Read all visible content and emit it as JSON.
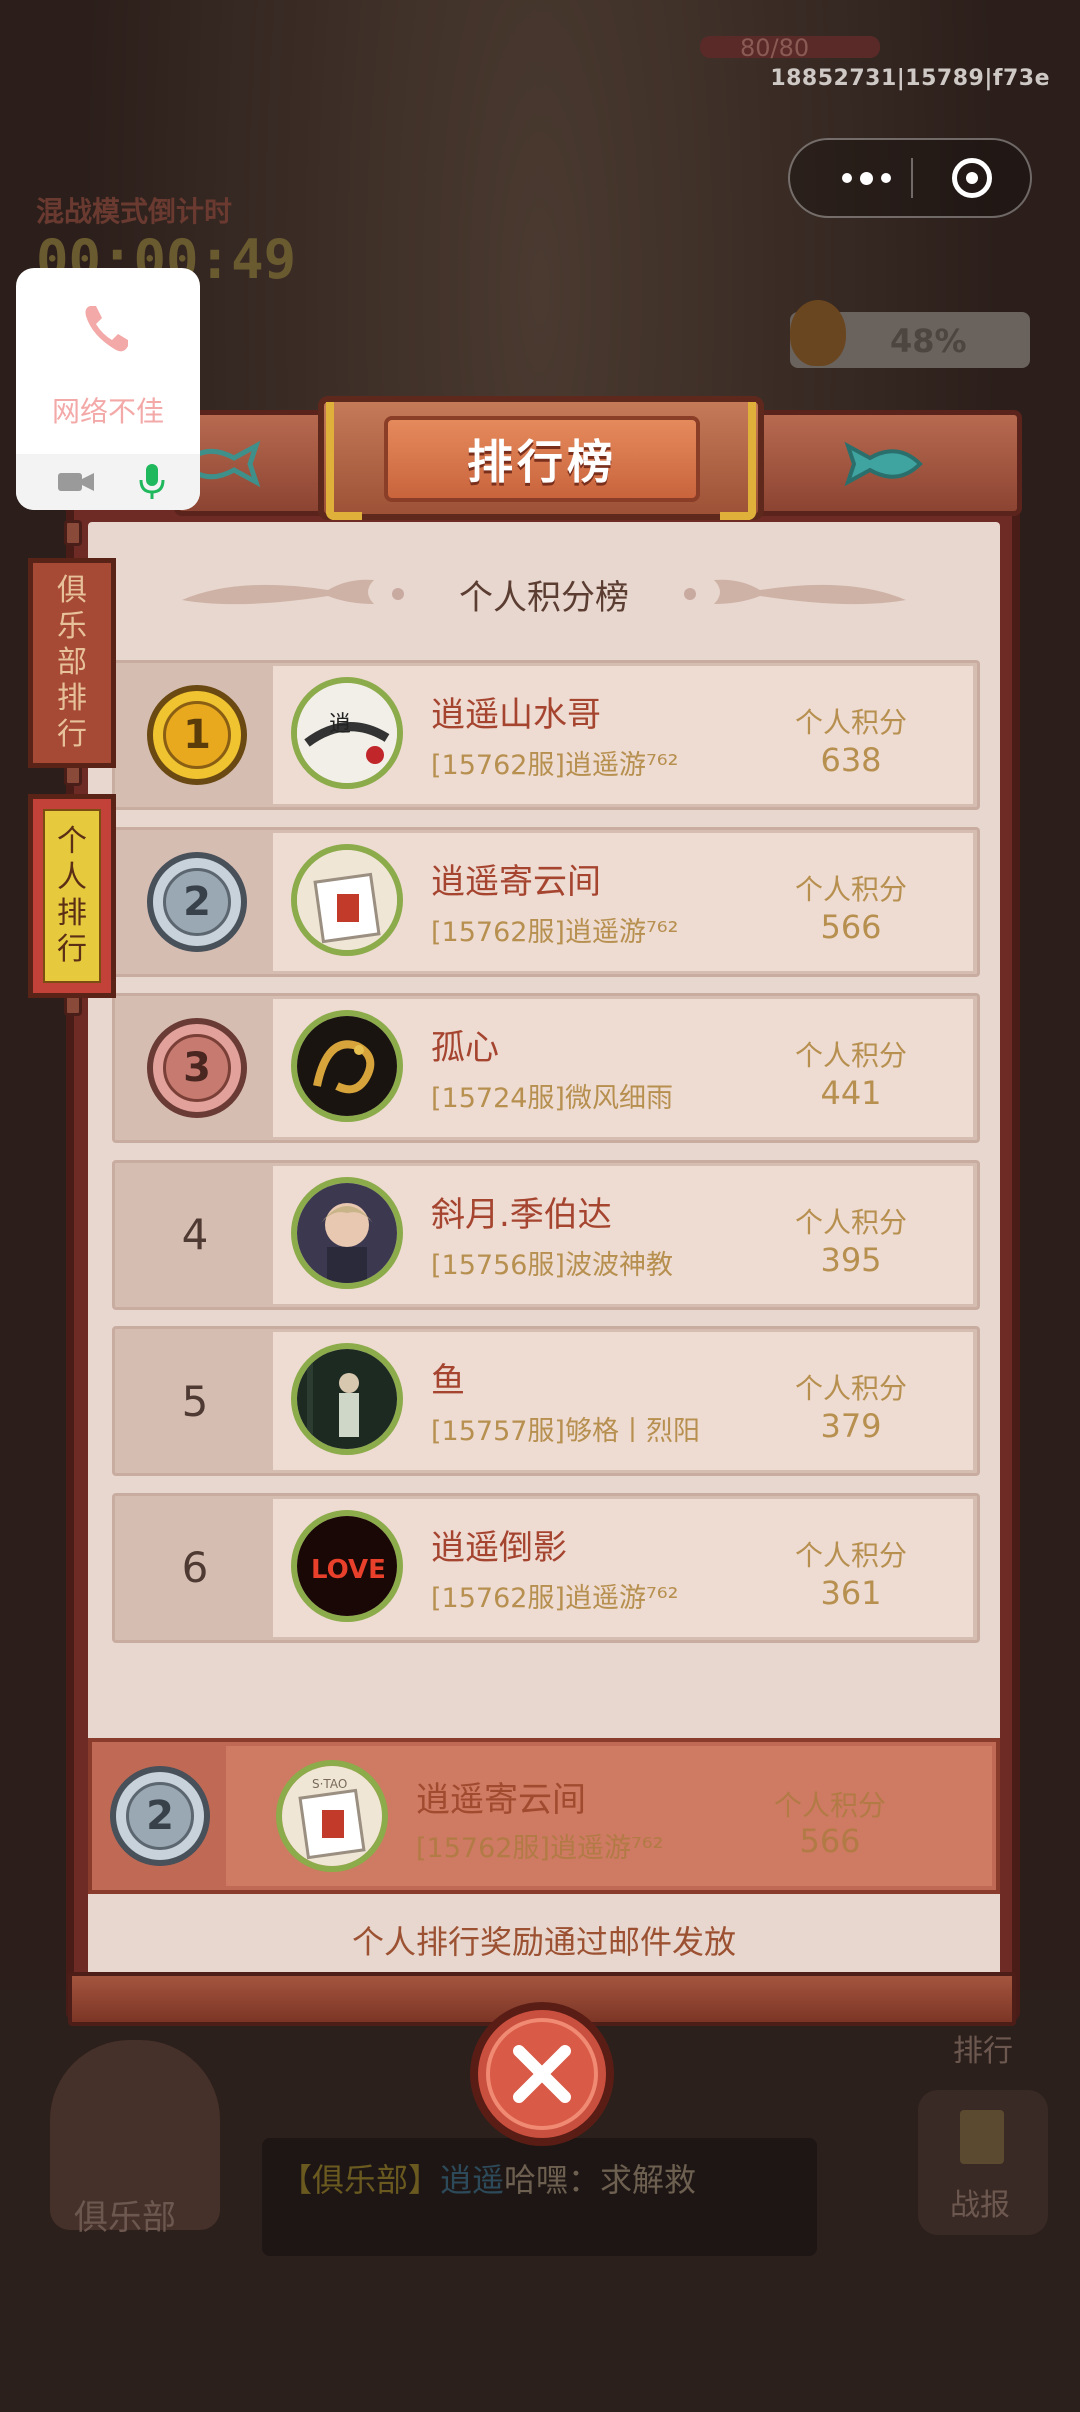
{
  "status": {
    "build_id": "18852731|15789|f73e"
  },
  "background": {
    "hp_text": "80/80",
    "countdown_label": "混战模式倒计时",
    "countdown": "00:00:49",
    "progress_text": "48%",
    "club_label": "俱乐部",
    "chat_channel": "【俱乐部】",
    "chat_nick": "逍遥",
    "chat_text": "哈嘿：求解救",
    "rank_side_label": "排行",
    "report_label": "战报"
  },
  "voip": {
    "status": "网络不佳",
    "color_phone": "#f3a9a8",
    "color_mic": "#1fb85c"
  },
  "leaderboard": {
    "title": "排行榜",
    "subtitle": "个人积分榜",
    "tabs": [
      {
        "label": "俱乐部排行",
        "active": false
      },
      {
        "label": "个人排行",
        "active": true
      }
    ],
    "score_label": "个人积分",
    "rows": [
      {
        "rank": "1",
        "medal": "gold",
        "name": "逍遥山水哥",
        "server": "[15762服]逍遥游⁷⁶²",
        "score": "638",
        "avatar": "calligraphy-avatar"
      },
      {
        "rank": "2",
        "medal": "silver",
        "name": "逍遥寄云间",
        "server": "[15762服]逍遥游⁷⁶²",
        "score": "566",
        "avatar": "sketch-avatar"
      },
      {
        "rank": "3",
        "medal": "bronze",
        "name": "孤心",
        "server": "[15724服]微风细雨",
        "score": "441",
        "avatar": "dragon-avatar"
      },
      {
        "rank": "4",
        "medal": "",
        "name": "斜月.季伯达",
        "server": "[15756服]波波神教",
        "score": "395",
        "avatar": "anime-avatar"
      },
      {
        "rank": "5",
        "medal": "",
        "name": "鱼",
        "server": "[15757服]够格丨烈阳",
        "score": "379",
        "avatar": "figure-avatar"
      },
      {
        "rank": "6",
        "medal": "",
        "name": "逍遥倒影",
        "server": "[15762服]逍遥游⁷⁶²",
        "score": "361",
        "avatar": "love-avatar"
      }
    ],
    "self": {
      "rank": "2",
      "name": "逍遥寄云间",
      "server": "[15762服]逍遥游⁷⁶²",
      "score": "566"
    },
    "reward_note": "个人排行奖励通过邮件发放"
  }
}
